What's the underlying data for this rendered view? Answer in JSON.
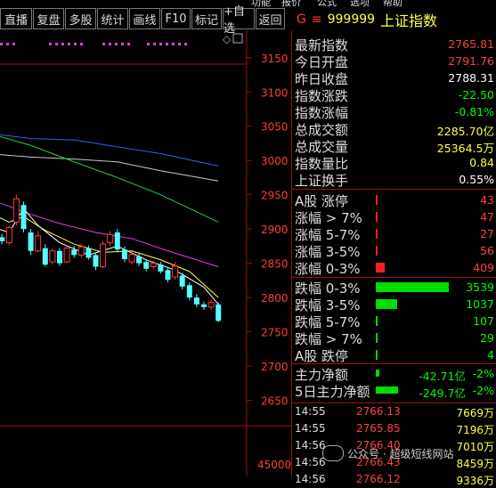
{
  "top_strip": [
    "功能",
    "报价",
    "公式",
    "选项",
    "帮助"
  ],
  "toolbar": [
    "直播",
    "复盘",
    "多股",
    "统计",
    "画线",
    "F10",
    "标记",
    "+自选",
    "返回"
  ],
  "header": {
    "g": "G",
    "menu": "≡",
    "code": "999999",
    "name": "上证指数"
  },
  "stats": [
    {
      "label": "最新指数",
      "value": "2765.81",
      "color": "#ff4040"
    },
    {
      "label": "今日开盘",
      "value": "2791.76",
      "color": "#ff4040"
    },
    {
      "label": "昨日收盘",
      "value": "2788.31",
      "color": "#ffffff"
    },
    {
      "label": "指数涨跌",
      "value": "-22.50",
      "color": "#00ff00"
    },
    {
      "label": "指数涨幅",
      "value": "-0.81%",
      "color": "#00ff00"
    },
    {
      "label": "总成交额",
      "value": "2285.70亿",
      "color": "#ffff40"
    },
    {
      "label": "总成交量",
      "value": "25364.5万",
      "color": "#ffff40"
    },
    {
      "label": "指数量比",
      "value": "0.84",
      "color": "#ffff40"
    },
    {
      "label": "上证换手",
      "value": "0.55%",
      "color": "#ffffff"
    }
  ],
  "up_dist": [
    {
      "label": "A股 涨停",
      "value": "43",
      "ratio": 0.0
    },
    {
      "label": "涨幅 > 7%",
      "value": "47",
      "ratio": 0.0
    },
    {
      "label": "涨幅 5-7%",
      "value": "27",
      "ratio": 0.0
    },
    {
      "label": "涨幅 3-5%",
      "value": "56",
      "ratio": 0.0
    },
    {
      "label": "涨幅 0-3%",
      "value": "409",
      "ratio": 0.12
    }
  ],
  "down_dist": [
    {
      "label": "跌幅 0-3%",
      "value": "3539",
      "ratio": 1.0
    },
    {
      "label": "跌幅 3-5%",
      "value": "1037",
      "ratio": 0.29
    },
    {
      "label": "跌幅 5-7%",
      "value": "107",
      "ratio": 0.03
    },
    {
      "label": "跌幅 > 7%",
      "value": "29",
      "ratio": 0.0
    },
    {
      "label": "A股 跌停",
      "value": "4",
      "ratio": 0.0
    }
  ],
  "flows": [
    {
      "label": "主力净额",
      "value": "-42.71亿",
      "pct": "-2%",
      "ratio": 0.05
    },
    {
      "label": "5日主力净额",
      "value": "-249.7亿",
      "pct": "-2%",
      "ratio": 0.3
    }
  ],
  "trades": [
    {
      "time": "14:55",
      "price": "2766.13",
      "vol": "7669万"
    },
    {
      "time": "14:55",
      "price": "2765.85",
      "vol": "7196万"
    },
    {
      "time": "14:56",
      "price": "2766.40",
      "vol": "7010万"
    },
    {
      "time": "14:56",
      "price": "2766.43",
      "vol": "8459万"
    },
    {
      "time": "14:56",
      "price": "2766.12",
      "vol": "9336万"
    }
  ],
  "axis": {
    "price_ticks": [
      "3150",
      "3100",
      "3050",
      "3000",
      "2950",
      "2900",
      "2850",
      "2800",
      "2750",
      "2700",
      "2650"
    ],
    "volume_label": "45000"
  },
  "watermark": "公众号 · 超级短线网站",
  "chart_data": {
    "type": "candlestick",
    "ylim": [
      2626,
      3190
    ],
    "candles": [
      {
        "o": 2885,
        "c": 2892,
        "h": 2897,
        "l": 2880
      },
      {
        "o": 2883,
        "c": 2890,
        "h": 2895,
        "l": 2878
      },
      {
        "o": 2888,
        "c": 2882,
        "h": 2893,
        "l": 2878
      },
      {
        "o": 2880,
        "c": 2902,
        "h": 2905,
        "l": 2876
      },
      {
        "o": 2910,
        "c": 2944,
        "h": 2950,
        "l": 2905
      },
      {
        "o": 2935,
        "c": 2900,
        "h": 2940,
        "l": 2895
      },
      {
        "o": 2895,
        "c": 2868,
        "h": 2900,
        "l": 2862
      },
      {
        "o": 2868,
        "c": 2890,
        "h": 2897,
        "l": 2866
      },
      {
        "o": 2872,
        "c": 2848,
        "h": 2878,
        "l": 2845
      },
      {
        "o": 2852,
        "c": 2868,
        "h": 2872,
        "l": 2848
      },
      {
        "o": 2868,
        "c": 2850,
        "h": 2872,
        "l": 2846
      },
      {
        "o": 2852,
        "c": 2872,
        "h": 2876,
        "l": 2850
      },
      {
        "o": 2870,
        "c": 2862,
        "h": 2875,
        "l": 2858
      },
      {
        "o": 2862,
        "c": 2874,
        "h": 2878,
        "l": 2858
      },
      {
        "o": 2872,
        "c": 2858,
        "h": 2876,
        "l": 2855
      },
      {
        "o": 2862,
        "c": 2845,
        "h": 2866,
        "l": 2840
      },
      {
        "o": 2845,
        "c": 2878,
        "h": 2882,
        "l": 2843
      },
      {
        "o": 2880,
        "c": 2892,
        "h": 2897,
        "l": 2875
      },
      {
        "o": 2895,
        "c": 2870,
        "h": 2900,
        "l": 2866
      },
      {
        "o": 2870,
        "c": 2856,
        "h": 2875,
        "l": 2852
      },
      {
        "o": 2852,
        "c": 2863,
        "h": 2867,
        "l": 2848
      },
      {
        "o": 2860,
        "c": 2850,
        "h": 2866,
        "l": 2846
      },
      {
        "o": 2852,
        "c": 2842,
        "h": 2856,
        "l": 2838
      },
      {
        "o": 2845,
        "c": 2850,
        "h": 2854,
        "l": 2842
      },
      {
        "o": 2848,
        "c": 2838,
        "h": 2852,
        "l": 2835
      },
      {
        "o": 2840,
        "c": 2826,
        "h": 2844,
        "l": 2822
      },
      {
        "o": 2830,
        "c": 2846,
        "h": 2852,
        "l": 2826
      },
      {
        "o": 2832,
        "c": 2816,
        "h": 2836,
        "l": 2812
      },
      {
        "o": 2818,
        "c": 2800,
        "h": 2822,
        "l": 2796
      },
      {
        "o": 2800,
        "c": 2790,
        "h": 2805,
        "l": 2786
      },
      {
        "o": 2790,
        "c": 2786,
        "h": 2794,
        "l": 2782
      },
      {
        "o": 2786,
        "c": 2793,
        "h": 2797,
        "l": 2782
      },
      {
        "o": 2790,
        "c": 2766,
        "h": 2793,
        "l": 2764
      }
    ],
    "ma_lines": [
      {
        "color": "#3a5cff",
        "points": [
          [
            0,
            3040
          ],
          [
            6,
            3032
          ],
          [
            12,
            3030
          ],
          [
            18,
            3020
          ],
          [
            24,
            3010
          ],
          [
            32,
            2992
          ]
        ]
      },
      {
        "color": "#c8c8c8",
        "points": [
          [
            0,
            3010
          ],
          [
            6,
            3005
          ],
          [
            12,
            3002
          ],
          [
            18,
            2998
          ],
          [
            24,
            2985
          ],
          [
            32,
            2970
          ]
        ]
      },
      {
        "color": "#2ecc40",
        "points": [
          [
            0,
            3040
          ],
          [
            6,
            3022
          ],
          [
            12,
            2998
          ],
          [
            18,
            2975
          ],
          [
            24,
            2950
          ],
          [
            32,
            2910
          ]
        ]
      },
      {
        "color": "#e040e0",
        "points": [
          [
            0,
            2945
          ],
          [
            5,
            2925
          ],
          [
            10,
            2908
          ],
          [
            15,
            2895
          ],
          [
            20,
            2886
          ],
          [
            25,
            2868
          ],
          [
            32,
            2845
          ]
        ]
      },
      {
        "color": "#ffff40",
        "points": [
          [
            0,
            2925
          ],
          [
            3,
            2910
          ],
          [
            5,
            2918
          ],
          [
            8,
            2898
          ],
          [
            12,
            2878
          ],
          [
            16,
            2866
          ],
          [
            20,
            2868
          ],
          [
            24,
            2855
          ],
          [
            28,
            2838
          ],
          [
            32,
            2800
          ]
        ]
      },
      {
        "color": "#ffffff",
        "points": [
          [
            0,
            2905
          ],
          [
            3,
            2895
          ],
          [
            5,
            2930
          ],
          [
            7,
            2905
          ],
          [
            10,
            2880
          ],
          [
            14,
            2862
          ],
          [
            18,
            2875
          ],
          [
            22,
            2855
          ],
          [
            26,
            2840
          ],
          [
            30,
            2815
          ],
          [
            32,
            2790
          ]
        ]
      }
    ]
  }
}
